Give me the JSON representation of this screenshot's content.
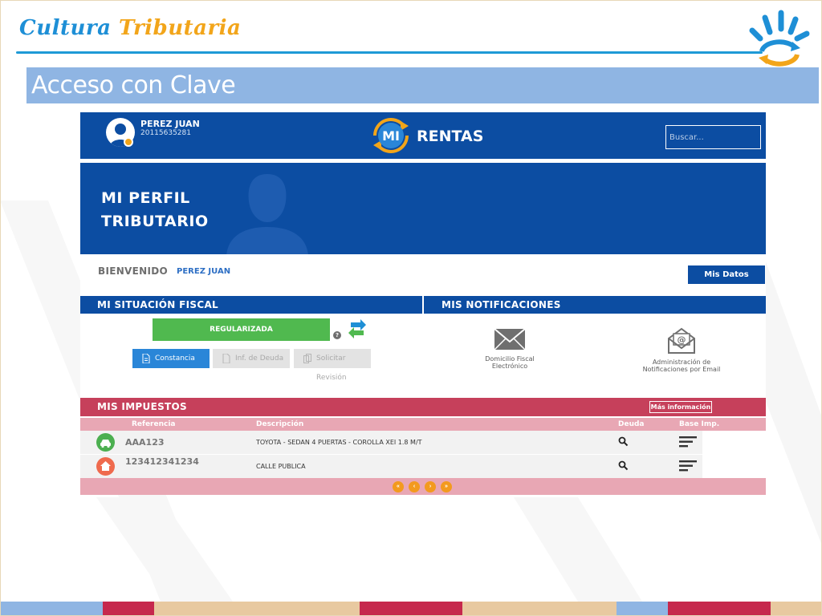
{
  "slide": {
    "brand_word1": "Cultura",
    "brand_word2": "Tributaria",
    "title": "Acceso con Clave"
  },
  "colors": {
    "brand_blue": "#1e8fd6",
    "brand_orange": "#f2a51a",
    "app_blue": "#0c4da2",
    "title_band": "#8fb5e3",
    "status_green": "#50b94f",
    "taxes_red": "#c6405b",
    "taxes_pink": "#e8a7b4"
  },
  "header": {
    "user_name": "PEREZ JUAN",
    "user_cuit": "20115635281",
    "logo_mi": "MI",
    "logo_rentas": "RENTAS",
    "search_placeholder": "Buscar..."
  },
  "hero": {
    "title_line1": "MI PERFIL",
    "title_line2": "TRIBUTARIO"
  },
  "welcome": {
    "label": "BIENVENIDO",
    "name": "PEREZ JUAN",
    "mis_datos_button": "Mis Datos"
  },
  "fiscal": {
    "title": "MI SITUACIÓN FISCAL",
    "status": "REGULARIZADA",
    "help": "?",
    "buttons": {
      "constancia": "Constancia",
      "deuda": "Inf. de Deuda",
      "revision": "Solicitar Revisión"
    }
  },
  "notifications": {
    "title": "MIS NOTIFICACIONES",
    "items": [
      {
        "line1": "Domicilio Fiscal",
        "line2": "Electrónico"
      },
      {
        "line1": "Administración de",
        "line2": "Notificaciones por Email"
      }
    ]
  },
  "taxes": {
    "title": "MIS IMPUESTOS",
    "more_info_button": "Más información",
    "columns": {
      "referencia": "Referencia",
      "descripcion": "Descripción",
      "deuda": "Deuda",
      "base": "Base Imp."
    },
    "rows": [
      {
        "icon": "car-icon",
        "color": "#4caf50",
        "ref": "AAA123",
        "desc": "TOYOTA - SEDAN 4 PUERTAS - COROLLA XEI 1.8 M/T"
      },
      {
        "icon": "house-icon",
        "color": "#ef6a4d",
        "ref": "123412341234",
        "desc": "CALLE PUBLICA"
      }
    ],
    "pager": [
      "«",
      "‹",
      "›",
      "»"
    ]
  }
}
